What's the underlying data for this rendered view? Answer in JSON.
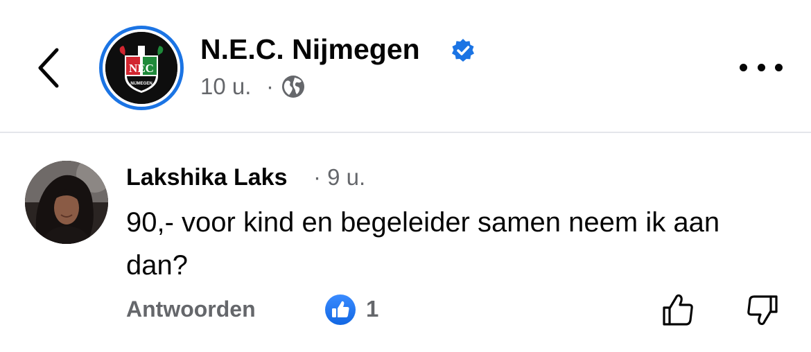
{
  "header": {
    "page_name": "N.E.C. Nijmegen",
    "post_time": "10 u.",
    "separator": "·",
    "avatar_lettering": "NEC",
    "avatar_sublettering": "NIJMEGEN",
    "icons": {
      "back": "chevron-left-icon",
      "verified": "verified-badge-icon",
      "audience": "globe-icon",
      "more": "more-options-icon"
    }
  },
  "comment": {
    "author": "Lakshika Laks",
    "time": "· 9 u.",
    "text": "90,- voor kind en begeleider samen neem ik aan dan?",
    "actions": {
      "reply_label": "Antwoorden",
      "like_count": "1"
    },
    "icons": {
      "reaction": "like-reaction-icon",
      "like": "thumbs-up-icon",
      "dislike": "thumbs-down-icon"
    }
  },
  "colors": {
    "accent": "#1b74e4",
    "text": "#050505",
    "secondary_text": "#65676b",
    "divider": "#e4e6eb",
    "background": "#ffffff"
  }
}
